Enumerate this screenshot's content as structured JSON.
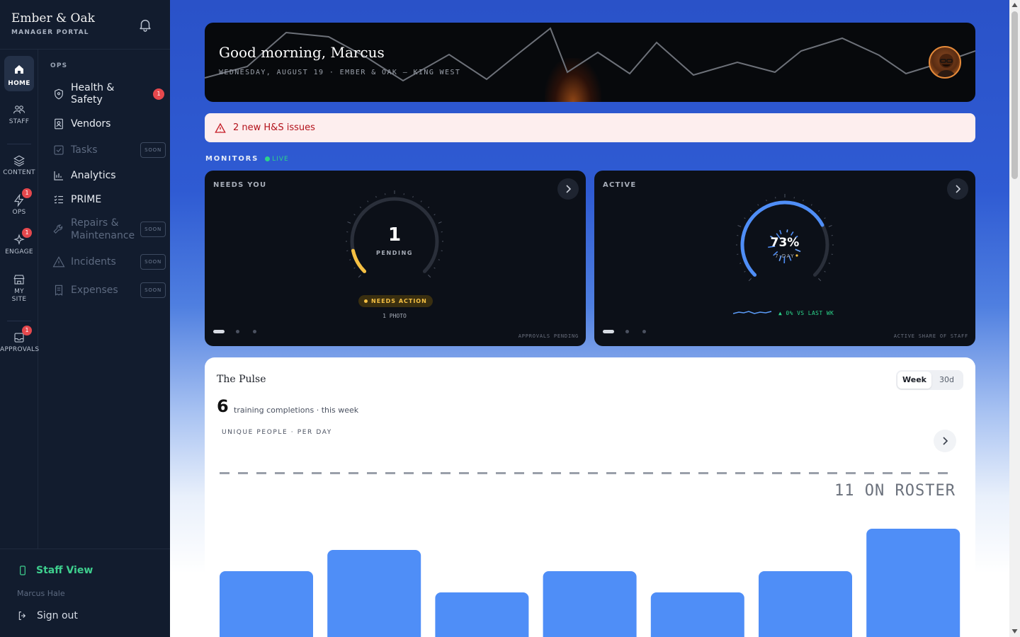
{
  "brand": {
    "name": "Ember & Oak",
    "subtitle": "MANAGER PORTAL"
  },
  "rail": {
    "home": "HOME",
    "staff": "STAFF",
    "content": "CONTENT",
    "ops": "OPS",
    "ops_badge": "1",
    "engage": "ENGAGE",
    "engage_badge": "1",
    "my_site": "MY SITE",
    "approvals": "APPROVALS",
    "approvals_badge": "1"
  },
  "menu": {
    "section": "OPS",
    "items": [
      {
        "label": "Health & Safety",
        "badge": "1",
        "icon": "shield-icon",
        "enabled": true
      },
      {
        "label": "Vendors",
        "icon": "contact-book-icon",
        "enabled": true
      },
      {
        "label": "Tasks",
        "tag": "SOON",
        "icon": "checkbox-icon",
        "enabled": false
      },
      {
        "label": "Analytics",
        "icon": "bar-chart-icon",
        "enabled": true
      },
      {
        "label": "PRIME",
        "icon": "checklist-icon",
        "enabled": true
      },
      {
        "label": "Repairs & Maintenance",
        "tag": "SOON",
        "icon": "wrench-icon",
        "enabled": false
      },
      {
        "label": "Incidents",
        "tag": "SOON",
        "icon": "warning-icon",
        "enabled": false
      },
      {
        "label": "Expenses",
        "tag": "SOON",
        "icon": "receipt-icon",
        "enabled": false
      }
    ]
  },
  "footer": {
    "staff_view": "Staff View",
    "user": "Marcus Hale",
    "sign_out": "Sign out"
  },
  "hero": {
    "greeting": "Good morning, Marcus",
    "subtitle": "WEDNESDAY, AUGUST 19 · EMBER & OAK — KING WEST"
  },
  "alert": {
    "text": "2 new H&S issues"
  },
  "monitors": {
    "title": "MONITORS",
    "live": "LIVE",
    "needs": {
      "title": "NEEDS YOU",
      "count": "1",
      "label": "PENDING",
      "badge": "NEEDS ACTION",
      "detail": "1 PHOTO",
      "footer": "APPROVALS PENDING",
      "gauge_fraction": 0.12
    },
    "active": {
      "title": "ACTIVE",
      "percent": "73%",
      "label": "7-DAY",
      "trend": "▲ 0% VS LAST WK",
      "footer": "ACTIVE SHARE OF STAFF",
      "gauge_fraction": 0.73
    }
  },
  "pulse": {
    "title": "The Pulse",
    "toggle": [
      "Week",
      "30d"
    ],
    "count": "6",
    "count_text": "training completions · this week",
    "metric": "UNIQUE PEOPLE · PER DAY",
    "roster": "11 ON ROSTER",
    "bar_values": [
      2,
      3,
      1,
      2,
      1,
      2,
      4
    ]
  },
  "colors": {
    "accent_blue": "#4f8ef7",
    "alert_red": "#b3121b",
    "live_green": "#2bd48a",
    "warn_yellow": "#f5c043"
  }
}
